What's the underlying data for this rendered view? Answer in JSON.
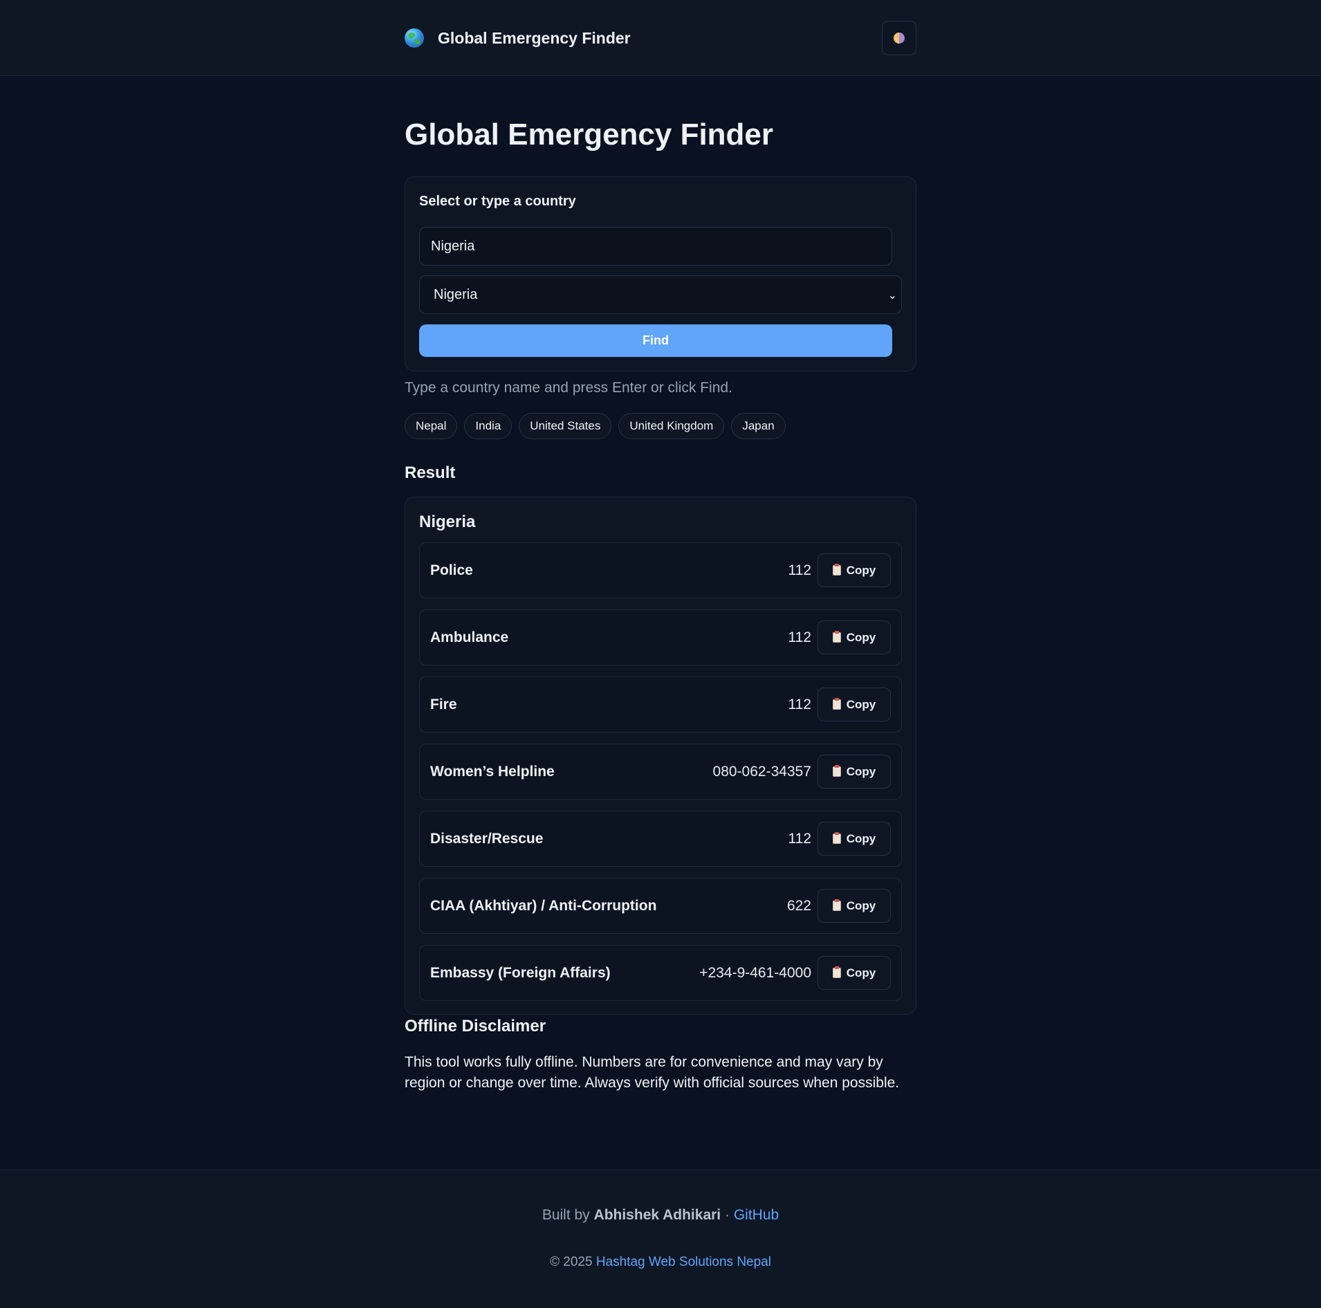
{
  "header": {
    "brand_icon": "globe-icon",
    "brand_name": "Global Emergency Finder",
    "theme_toggle_icon": "half-moon-icon"
  },
  "main": {
    "title": "Global Emergency Finder",
    "search": {
      "label": "Select or type a country",
      "input_value": "Nigeria",
      "select_value": "Nigeria",
      "find_label": "Find"
    },
    "hint": "Type a country name and press Enter or click Find.",
    "quick_picks": [
      "Nepal",
      "India",
      "United States",
      "United Kingdom",
      "Japan"
    ],
    "result_heading": "Result",
    "result": {
      "country": "Nigeria",
      "copy_label": "Copy",
      "rows": [
        {
          "label": "Police",
          "number": "112"
        },
        {
          "label": "Ambulance",
          "number": "112"
        },
        {
          "label": "Fire",
          "number": "112"
        },
        {
          "label": "Women’s Helpline",
          "number": "080-062-34357"
        },
        {
          "label": "Disaster/Rescue",
          "number": "112"
        },
        {
          "label": "CIAA (Akhtiyar) / Anti-Corruption",
          "number": "622"
        },
        {
          "label": "Embassy (Foreign Affairs)",
          "number": "+234-9-461-4000"
        }
      ]
    },
    "disclaimer": {
      "heading": "Offline Disclaimer",
      "text": "This tool works fully offline. Numbers are for convenience and may vary by region or change over time. Always verify with official sources when possible."
    }
  },
  "footer": {
    "built_by_prefix": "Built by",
    "author": "Abhishek Adhikari",
    "separator": "·",
    "github_label": "GitHub",
    "copyright_prefix": "© 2025",
    "company": "Hashtag Web Solutions Nepal"
  },
  "colors": {
    "background": "#0a1120",
    "surface": "#0e1624",
    "accent": "#60a5fa",
    "muted_text": "#96a2b3"
  }
}
